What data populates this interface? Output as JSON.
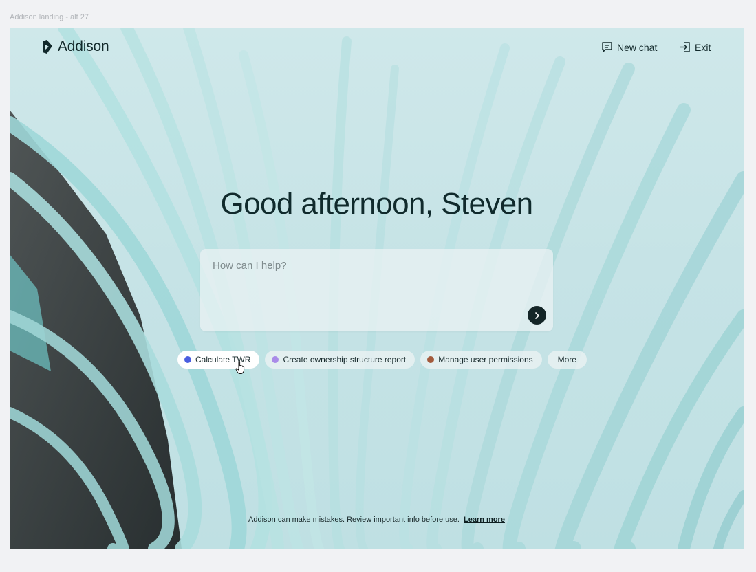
{
  "frame_label": "Addison landing - alt 27",
  "header": {
    "brand_name": "Addison",
    "new_chat_label": "New chat",
    "exit_label": "Exit"
  },
  "greeting": "Good afternoon, Steven",
  "composer": {
    "placeholder": "How can I help?",
    "value": ""
  },
  "suggestions": [
    {
      "label": "Calculate TWR",
      "dot_color": "#4a5ee0",
      "active": true
    },
    {
      "label": "Create ownership structure report",
      "dot_color": "#a98be8",
      "active": false
    },
    {
      "label": "Manage user permissions",
      "dot_color": "#a35a3c",
      "active": false
    },
    {
      "label": "More",
      "dot_color": null,
      "active": false
    }
  ],
  "disclaimer": {
    "text": "Addison can make mistakes. Review important info before use.",
    "link_label": "Learn more"
  },
  "icons": {
    "brand": "addison-logo-icon",
    "new_chat": "chat-bubble-icon",
    "exit": "exit-icon",
    "send": "chevron-right-icon",
    "cursor": "hand-pointer-icon"
  },
  "colors": {
    "text_primary": "#102a2c",
    "send_button": "#142527",
    "background_tint": "#c6e3e6"
  }
}
